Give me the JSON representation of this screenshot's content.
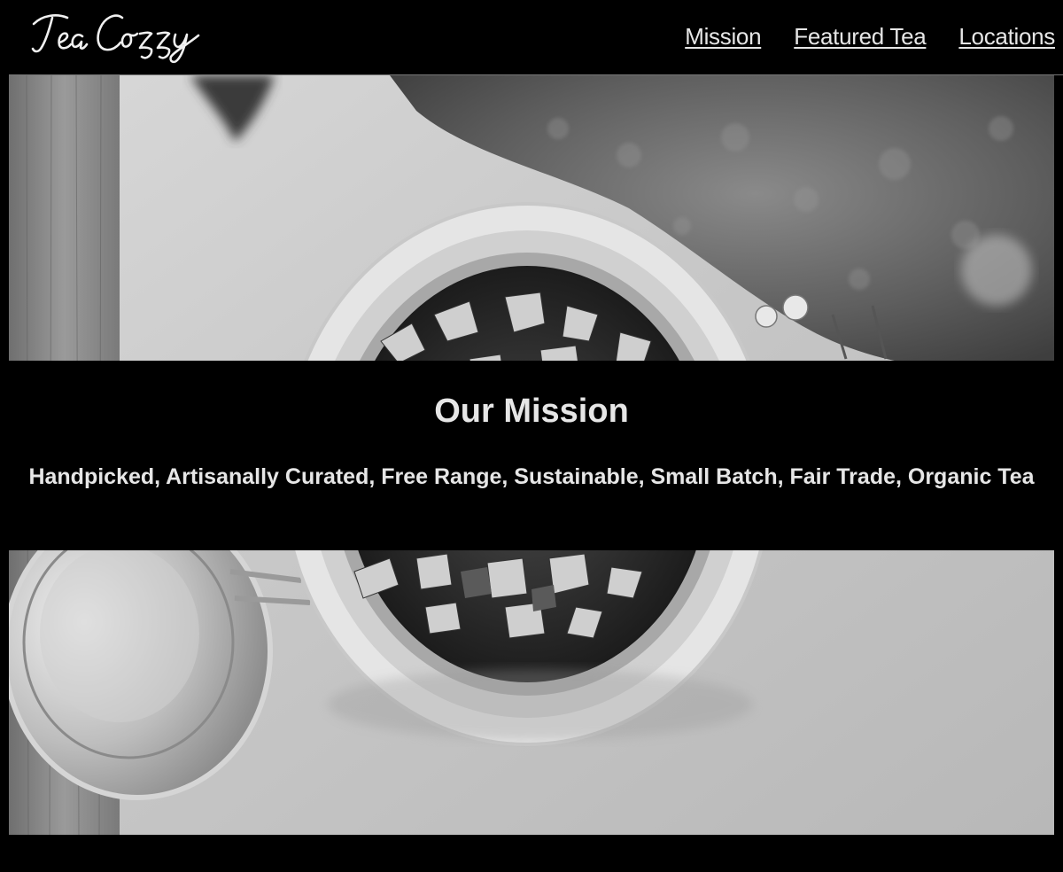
{
  "brand": {
    "name": "Tea Cozy"
  },
  "nav": {
    "items": [
      {
        "label": "Mission"
      },
      {
        "label": "Featured Tea"
      },
      {
        "label": "Locations"
      }
    ]
  },
  "mission": {
    "title": "Our Mission",
    "text": "Handpicked, Artisanally Curated, Free Range, Sustainable, Small Batch, Fair Trade, Organic Tea"
  },
  "colors": {
    "background": "#000000",
    "text": "#e6e6e6"
  },
  "hero_image": {
    "icon": "loose-tea-jar-image"
  }
}
